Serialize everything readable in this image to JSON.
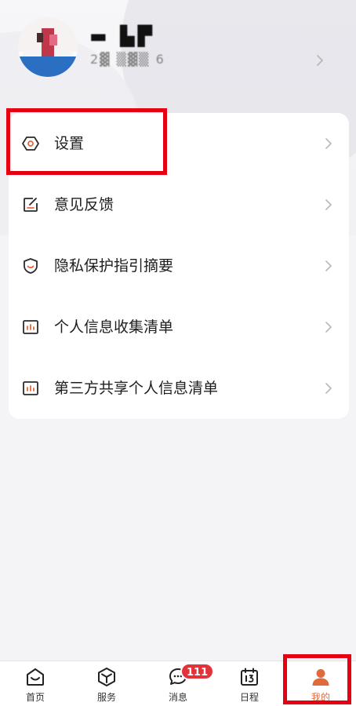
{
  "profile": {
    "name": "▬ ▙▛",
    "id_masked": "2▓ ▒▓▒ 6"
  },
  "menu": {
    "items": [
      {
        "key": "settings",
        "label": "设置",
        "icon": "hexagon-settings-icon"
      },
      {
        "key": "feedback",
        "label": "意见反馈",
        "icon": "edit-note-icon"
      },
      {
        "key": "privacy",
        "label": "隐私保护指引摘要",
        "icon": "shield-icon"
      },
      {
        "key": "personal-info",
        "label": "个人信息收集清单",
        "icon": "bar-chart-icon"
      },
      {
        "key": "third-party",
        "label": "第三方共享个人信息清单",
        "icon": "bar-chart-icon"
      }
    ]
  },
  "tabbar": {
    "tabs": [
      {
        "key": "home",
        "label": "首页",
        "icon": "home-smile-icon"
      },
      {
        "key": "services",
        "label": "服务",
        "icon": "cube-icon"
      },
      {
        "key": "messages",
        "label": "消息",
        "icon": "chat-bubble-icon",
        "badge": "111"
      },
      {
        "key": "schedule",
        "label": "日程",
        "icon": "calendar-13-icon"
      },
      {
        "key": "mine",
        "label": "我的",
        "icon": "person-icon",
        "active": true
      }
    ]
  },
  "colors": {
    "accent": "#e06a3c",
    "badge": "#e2323a",
    "highlight_box": "#e60012"
  }
}
